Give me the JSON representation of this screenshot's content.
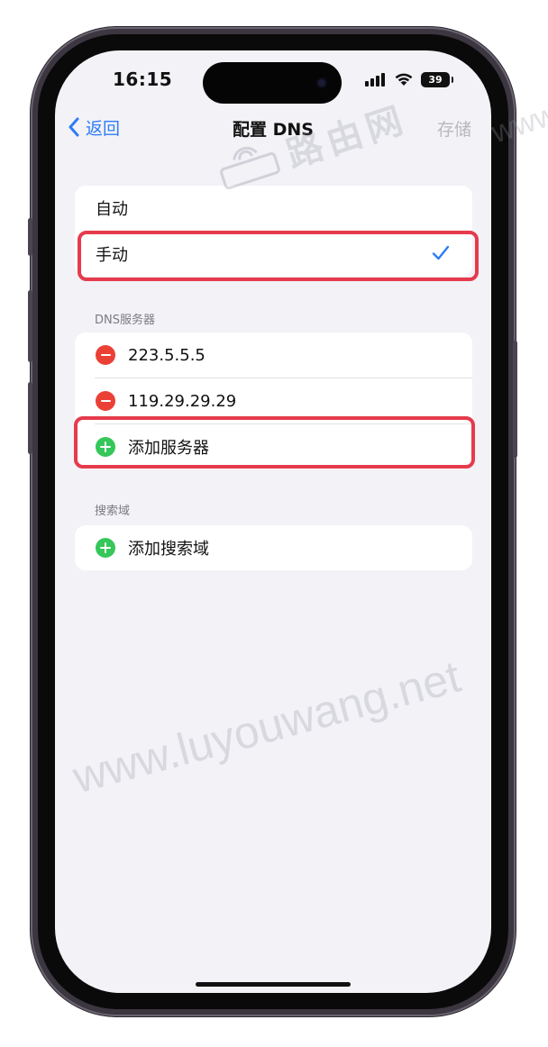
{
  "status_bar": {
    "time": "16:15",
    "battery": "39",
    "icons": [
      "signal-icon",
      "wifi-icon",
      "battery-icon"
    ]
  },
  "nav": {
    "back_label": "返回",
    "title": "配置 DNS",
    "save_label": "存储"
  },
  "mode_group": {
    "items": [
      {
        "label": "自动",
        "selected": false
      },
      {
        "label": "手动",
        "selected": true
      }
    ]
  },
  "dns_section": {
    "header": "DNS服务器",
    "servers": [
      "223.5.5.5",
      "119.29.29.29"
    ],
    "add_label": "添加服务器"
  },
  "search_section": {
    "header": "搜索域",
    "add_label": "添加搜索域"
  },
  "watermark": {
    "text": "www.luyouwang.net",
    "logo_text": "路由网"
  },
  "colors": {
    "accent": "#2f7cf6",
    "highlight": "#e53b4c",
    "delete": "#eb4036",
    "add": "#35c759",
    "background": "#f2f2f7"
  }
}
